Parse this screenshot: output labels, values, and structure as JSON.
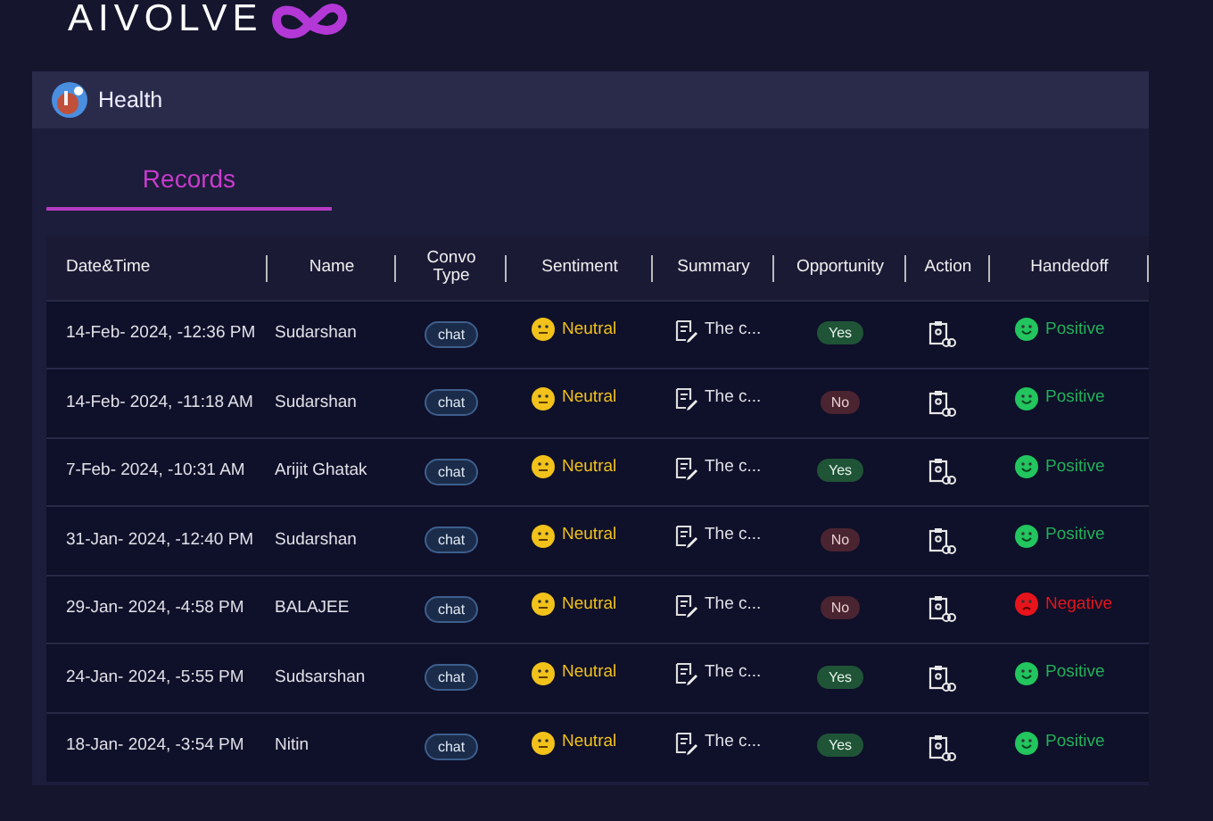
{
  "brand": {
    "logo_text": "AIVOLVE"
  },
  "panel": {
    "title": "Health"
  },
  "tabs": [
    {
      "label": "Records",
      "selected": true
    }
  ],
  "table": {
    "columns": [
      "Date&Time",
      "Name",
      "Convo Type",
      "Sentiment",
      "Summary",
      "Opportunity",
      "Action",
      "Handedoff"
    ],
    "rows": [
      {
        "datetime": "14-Feb- 2024, -12:36 PM",
        "name": "Sudarshan",
        "convo_type": "chat",
        "sentiment": {
          "label": "Neutral",
          "kind": "neutral"
        },
        "summary": "The c...",
        "opportunity": {
          "label": "Yes",
          "kind": "yes"
        },
        "handedoff": {
          "label": "Positive",
          "kind": "positive"
        }
      },
      {
        "datetime": "14-Feb- 2024, -11:18 AM",
        "name": "Sudarshan",
        "convo_type": "chat",
        "sentiment": {
          "label": "Neutral",
          "kind": "neutral"
        },
        "summary": "The c...",
        "opportunity": {
          "label": "No",
          "kind": "no"
        },
        "handedoff": {
          "label": "Positive",
          "kind": "positive"
        }
      },
      {
        "datetime": "7-Feb- 2024, -10:31 AM",
        "name": "Arijit Ghatak",
        "convo_type": "chat",
        "sentiment": {
          "label": "Neutral",
          "kind": "neutral"
        },
        "summary": "The c...",
        "opportunity": {
          "label": "Yes",
          "kind": "yes"
        },
        "handedoff": {
          "label": "Positive",
          "kind": "positive"
        }
      },
      {
        "datetime": "31-Jan- 2024, -12:40 PM",
        "name": "Sudarshan",
        "convo_type": "chat",
        "sentiment": {
          "label": "Neutral",
          "kind": "neutral"
        },
        "summary": "The c...",
        "opportunity": {
          "label": "No",
          "kind": "no"
        },
        "handedoff": {
          "label": "Positive",
          "kind": "positive"
        }
      },
      {
        "datetime": "29-Jan- 2024, -4:58 PM",
        "name": "BALAJEE",
        "convo_type": "chat",
        "sentiment": {
          "label": "Neutral",
          "kind": "neutral"
        },
        "summary": "The c...",
        "opportunity": {
          "label": "No",
          "kind": "no"
        },
        "handedoff": {
          "label": "Negative",
          "kind": "negative"
        }
      },
      {
        "datetime": "24-Jan- 2024, -5:55 PM",
        "name": "Sudsarshan",
        "convo_type": "chat",
        "sentiment": {
          "label": "Neutral",
          "kind": "neutral"
        },
        "summary": "The c...",
        "opportunity": {
          "label": "Yes",
          "kind": "yes"
        },
        "handedoff": {
          "label": "Positive",
          "kind": "positive"
        }
      },
      {
        "datetime": "18-Jan- 2024, -3:54 PM",
        "name": "Nitin",
        "convo_type": "chat",
        "sentiment": {
          "label": "Neutral",
          "kind": "neutral"
        },
        "summary": "The c...",
        "opportunity": {
          "label": "Yes",
          "kind": "yes"
        },
        "handedoff": {
          "label": "Positive",
          "kind": "positive"
        }
      }
    ]
  }
}
